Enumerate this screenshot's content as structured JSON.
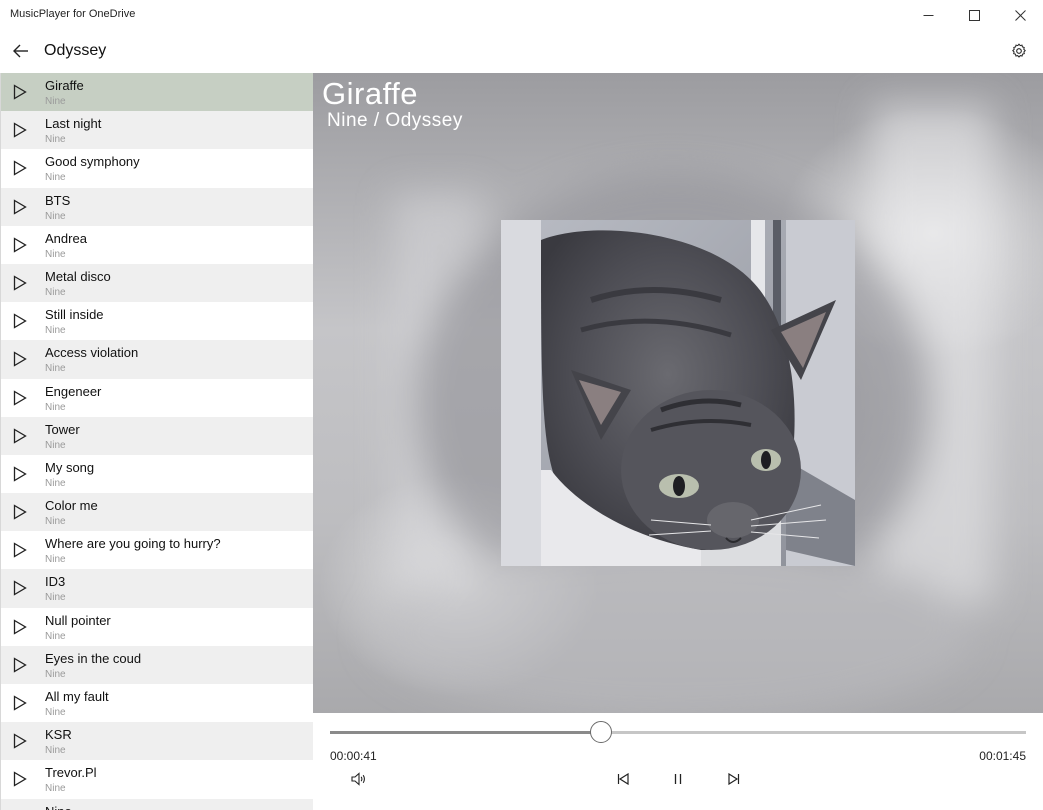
{
  "window": {
    "title": "MusicPlayer for OneDrive"
  },
  "header": {
    "title": "Odyssey"
  },
  "tracks": [
    {
      "name": "Giraffe",
      "artist": "Nine",
      "active": true
    },
    {
      "name": "Last night",
      "artist": "Nine"
    },
    {
      "name": "Good symphony",
      "artist": "Nine"
    },
    {
      "name": "BTS",
      "artist": "Nine"
    },
    {
      "name": "Andrea",
      "artist": "Nine"
    },
    {
      "name": "Metal disco",
      "artist": "Nine"
    },
    {
      "name": "Still inside",
      "artist": "Nine"
    },
    {
      "name": "Access violation",
      "artist": "Nine"
    },
    {
      "name": "Engeneer",
      "artist": "Nine"
    },
    {
      "name": "Tower",
      "artist": "Nine"
    },
    {
      "name": "My song",
      "artist": "Nine"
    },
    {
      "name": "Color me",
      "artist": "Nine"
    },
    {
      "name": "Where are you going to hurry?",
      "artist": "Nine"
    },
    {
      "name": "ID3",
      "artist": "Nine"
    },
    {
      "name": "Null pointer",
      "artist": "Nine"
    },
    {
      "name": "Eyes in the coud",
      "artist": "Nine"
    },
    {
      "name": "All my fault",
      "artist": "Nine"
    },
    {
      "name": "KSR",
      "artist": "Nine"
    },
    {
      "name": "Trevor.Pl",
      "artist": "Nine"
    },
    {
      "name": "Nine",
      "artist": ""
    }
  ],
  "now_playing": {
    "title": "Giraffe",
    "subtitle": "Nine / Odyssey",
    "album_art_icon": "cat-photo"
  },
  "player": {
    "elapsed": "00:00:41",
    "total": "00:01:45",
    "progress_fraction": 0.39,
    "state": "playing"
  },
  "icons": {
    "back": "arrow-left-icon",
    "settings": "gear-icon",
    "minimize": "minimize-icon",
    "maximize": "maximize-icon",
    "close": "close-icon",
    "play": "play-icon",
    "volume": "volume-icon",
    "previous": "previous-icon",
    "pause": "pause-icon",
    "next": "next-icon"
  },
  "colors": {
    "active_row": "#c6cfc3",
    "alt_row": "#efefef",
    "subtext": "#9a9a9a"
  }
}
